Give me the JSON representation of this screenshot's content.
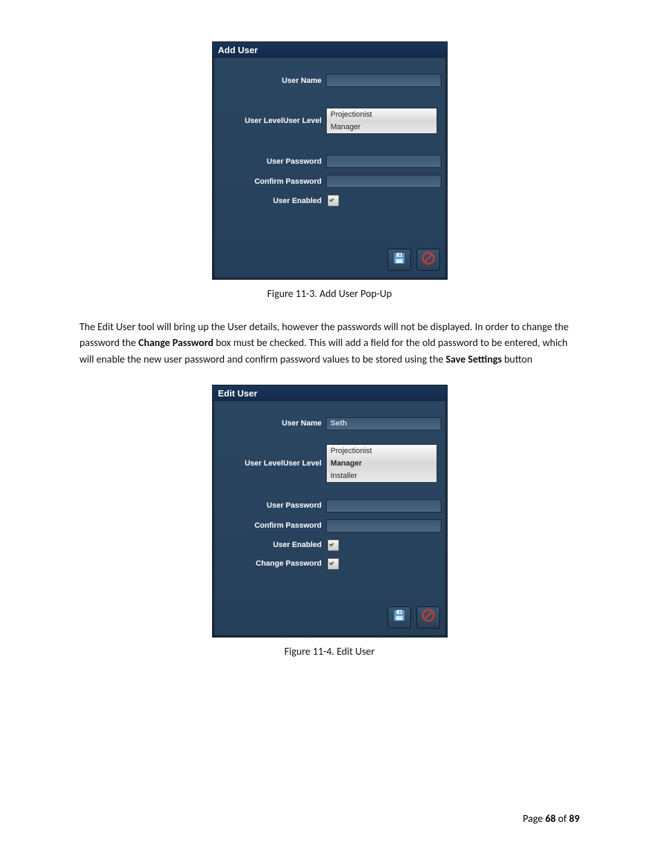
{
  "addUser": {
    "title": "Add User",
    "labels": {
      "userName": "User Name",
      "userLevel": "User LevelUser Level",
      "userPassword": "User Password",
      "confirmPassword": "Confirm Password",
      "userEnabled": "User Enabled"
    },
    "userNameValue": "",
    "userLevelOptions": [
      "Projectionist",
      "Manager"
    ],
    "userPasswordValue": "",
    "confirmPasswordValue": "",
    "userEnabledChecked": true
  },
  "figure1Caption": "Figure 11-3.  Add User Pop-Up",
  "paragraph": {
    "t1": "The Edit User tool will bring up the User details, however the passwords will not be displayed.  In order to change the password the ",
    "b1": "Change Password",
    "t2": " box must be checked.  This will add a field for the old password to be entered, which will enable the new user password and confirm password values to be stored using the ",
    "b2": "Save Settings",
    "t3": " button"
  },
  "editUser": {
    "title": "Edit User",
    "labels": {
      "userName": "User Name",
      "userLevel": "User LevelUser Level",
      "userPassword": "User Password",
      "confirmPassword": "Confirm Password",
      "userEnabled": "User Enabled",
      "changePassword": "Change Password"
    },
    "userNameValue": "Seth",
    "userLevelOptions": [
      "Projectionist",
      "Manager",
      "Installer"
    ],
    "userPasswordValue": "",
    "confirmPasswordValue": "",
    "userEnabledChecked": true,
    "changePasswordChecked": true
  },
  "figure2Caption": "Figure 11-4.  Edit User",
  "footer": {
    "t1": "Page ",
    "pageNum": "68",
    "t2": " of ",
    "pageTotal": "89"
  }
}
